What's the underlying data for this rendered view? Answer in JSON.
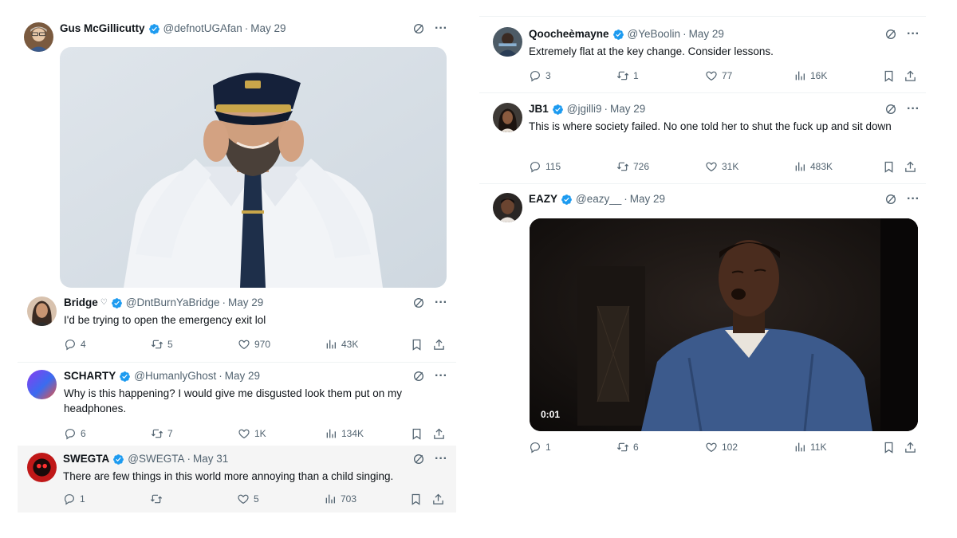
{
  "left_column": {
    "main_post": {
      "name": "Gus McGillicutty",
      "handle": "@defnotUGAfan",
      "separator": "·",
      "date": "May 29",
      "media": "photo-pilot-covering-ears"
    },
    "replies": [
      {
        "name": "Bridge",
        "handle": "@DntBurnYaBridge",
        "separator": "·",
        "date": "May 29",
        "text": "I'd be trying to open the emergency exit lol",
        "replies": "4",
        "retweets": "5",
        "likes": "970",
        "views": "43K"
      },
      {
        "name": "SCHARTY",
        "handle": "@HumanlyGhost",
        "separator": "·",
        "date": "May 29",
        "text": "Why is this happening? I would give me disgusted look them put on my headphones.",
        "replies": "6",
        "retweets": "7",
        "likes": "1K",
        "views": "134K"
      },
      {
        "name": "SWEGTA",
        "handle": "@SWEGTA",
        "separator": "·",
        "date": "May 31",
        "text": "There are few things in this world more annoying than a child singing.",
        "replies": "1",
        "retweets": "",
        "likes": "5",
        "views": "703"
      }
    ]
  },
  "right_column": {
    "posts": [
      {
        "name": "Qoocheèmayne",
        "handle": "@YeBoolin",
        "separator": "·",
        "date": "May 29",
        "text": "Extremely flat at the key change. Consider lessons.",
        "replies": "3",
        "retweets": "1",
        "likes": "77",
        "views": "16K"
      },
      {
        "name": "JB1",
        "handle": "@jgilli9",
        "separator": "·",
        "date": "May 29",
        "text": "This is where society failed.  No one told her to shut the fuck up and sit down",
        "replies": "115",
        "retweets": "726",
        "likes": "31K",
        "views": "483K"
      },
      {
        "name": "EAZY",
        "handle": "@eazy__",
        "separator": "·",
        "date": "May 29",
        "video_time": "0:01",
        "media": "video-man-singing",
        "replies": "1",
        "retweets": "6",
        "likes": "102",
        "views": "11K"
      }
    ]
  },
  "colors": {
    "verified_blue": "#1d9bf0",
    "text_primary": "#0f1419",
    "text_secondary": "#536471",
    "divider": "#eff3f4",
    "shaded_row": "#f5f5f5"
  },
  "icons": [
    "verified-badge-icon",
    "grok-icon",
    "more-icon",
    "reply-icon",
    "retweet-icon",
    "like-icon",
    "views-icon",
    "bookmark-icon",
    "share-icon"
  ]
}
